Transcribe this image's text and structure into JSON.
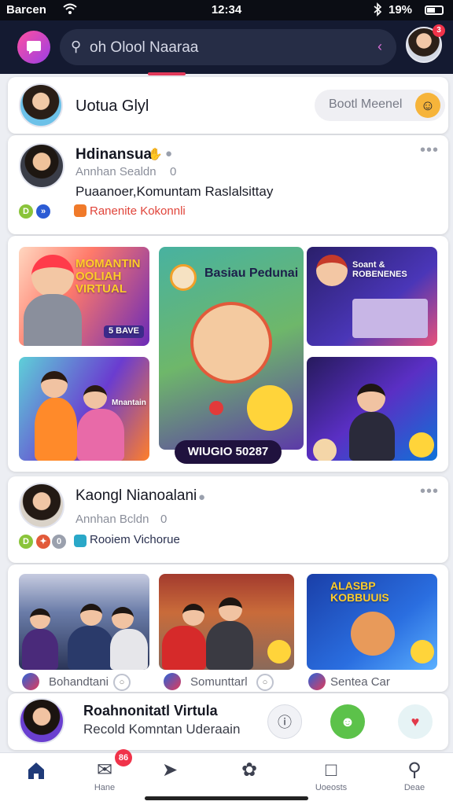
{
  "status_bar": {
    "carrier": "Barcen",
    "time": "12:34",
    "battery": "19%"
  },
  "header": {
    "search_text": "oh Olool Naaraa",
    "notification_count": ""
  },
  "topbar": {
    "name": "Uotua Glyl",
    "pill_label": "Bootl Meenel"
  },
  "post1": {
    "name": "Hdinansua",
    "sub": "Annhan Sealdn",
    "sub_count": "0",
    "desc": "Puaanoer,Komuntam Raslalsittay",
    "tag": "Ranenite Kokonnli"
  },
  "grid1": {
    "tile1_title": "MOMANTIN OOLIAH VIRTUAL",
    "tile1_badge": "5 BAVE",
    "tile2_title": "Basiau Pedunai",
    "tile3_title": "Soant & ROBENENES",
    "tile5_title": "Mnantain",
    "overlay": "WIUGIO 50287"
  },
  "post2": {
    "name": "Kaongl Nianoalani",
    "sub": "Annhan Bcldn",
    "sub_count": "0",
    "tag": "Rooiem Vichorue"
  },
  "grid2": {
    "tile3_title": "ALASBP KOBBUUIS",
    "labels": [
      "Bohandtani",
      "Somunttarl",
      "Sentea Car"
    ]
  },
  "miniplayer": {
    "title": "Roahnonitatl Virtula",
    "subtitle": "Recold Komntan Uderaain"
  },
  "bottom_nav": {
    "badge": "86",
    "items": [
      {
        "label": ""
      },
      {
        "label": "Hane"
      },
      {
        "label": ""
      },
      {
        "label": ""
      },
      {
        "label": "Uoeosts"
      },
      {
        "label": "Deae"
      }
    ]
  },
  "colors": {
    "accent": "#f0334a",
    "header_bg": "#141a31",
    "brand": "#9a3fe6"
  }
}
